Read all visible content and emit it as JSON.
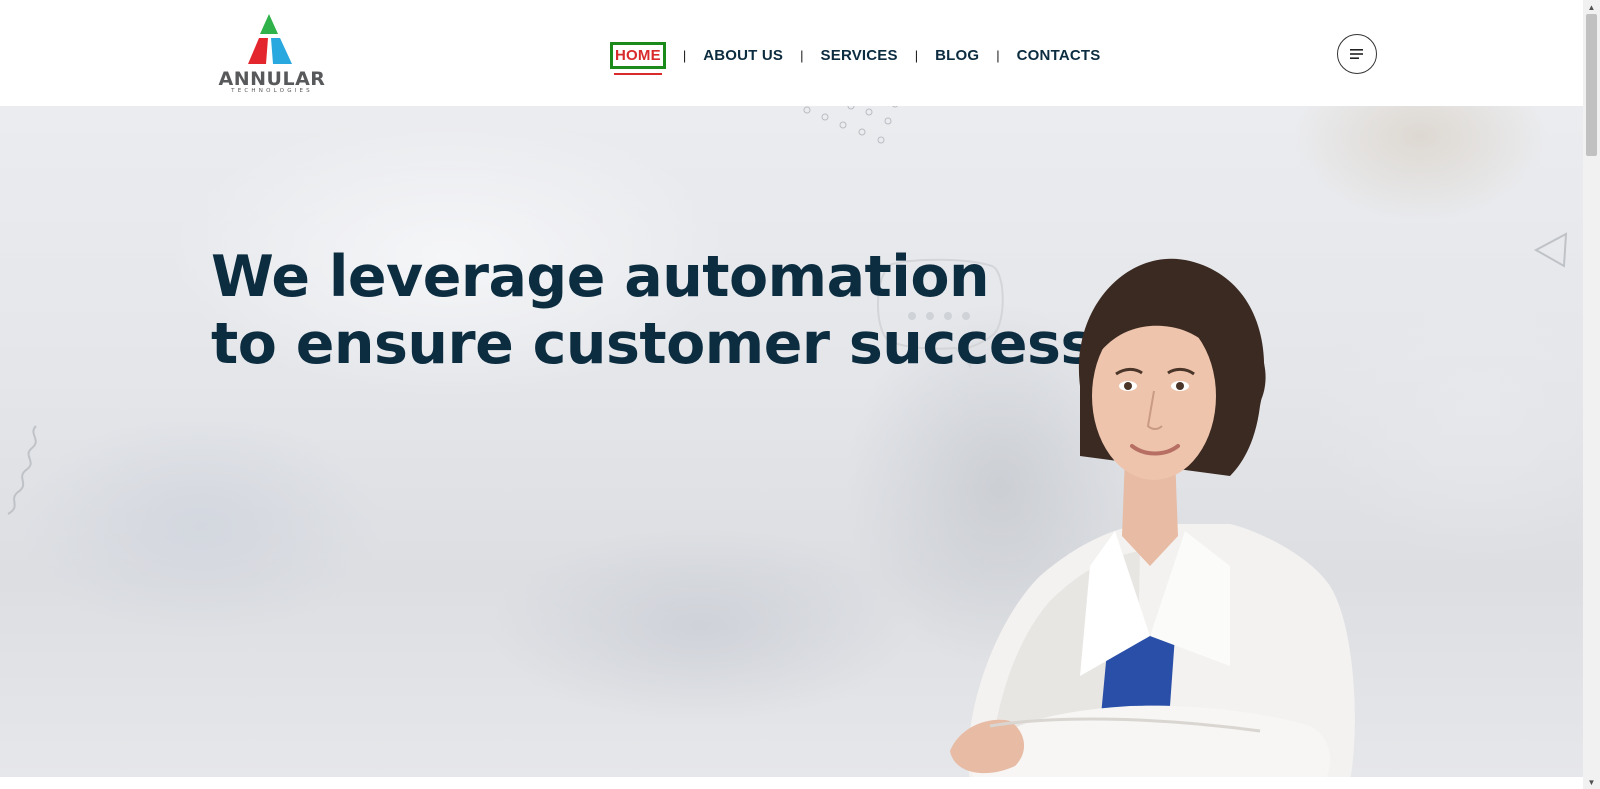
{
  "brand": {
    "name": "ANNULAR",
    "tagline": "TECHNOLOGIES",
    "colors": {
      "green": "#2fb24a",
      "red": "#e3262e",
      "blue": "#29a7df",
      "gray": "#58595b"
    }
  },
  "nav": {
    "items": [
      {
        "label": "HOME",
        "active": true
      },
      {
        "label": "ABOUT US",
        "active": false
      },
      {
        "label": "SERVICES",
        "active": false
      },
      {
        "label": "BLOG",
        "active": false
      },
      {
        "label": "CONTACTS",
        "active": false
      }
    ],
    "separator": "|",
    "menu_icon": "hamburger-icon"
  },
  "hero": {
    "heading_line1": "We leverage automation",
    "heading_line2": "to ensure customer success",
    "heading_color": "#0c2c40"
  },
  "colors": {
    "nav_text": "#0c2c40",
    "nav_active": "#d92b2b",
    "nav_focus_outline": "#1a8a1a"
  }
}
